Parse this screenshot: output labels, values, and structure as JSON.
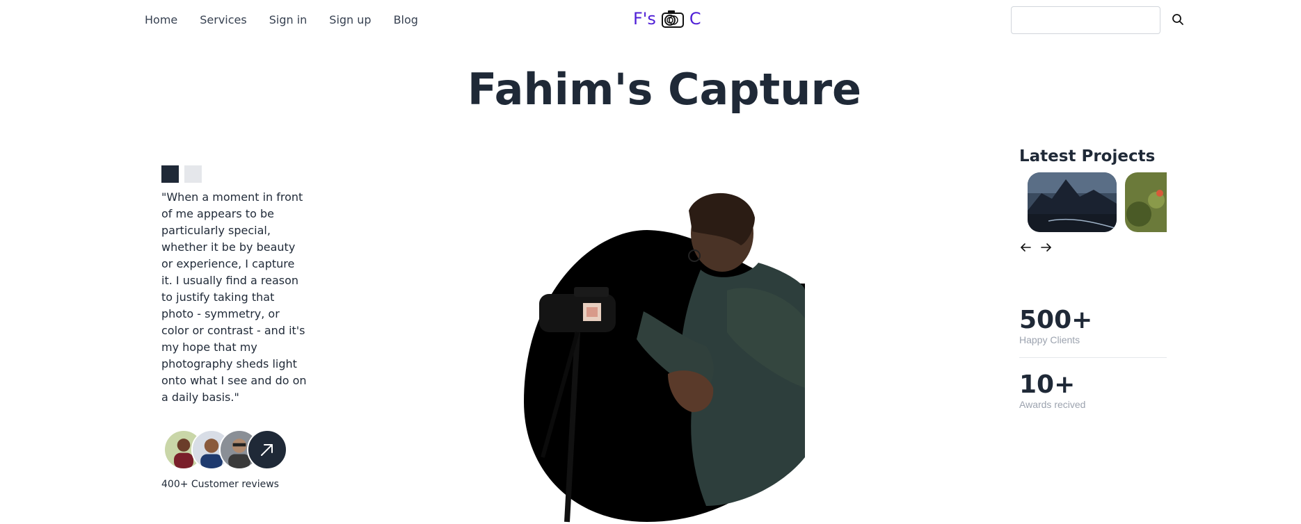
{
  "nav": {
    "links": [
      "Home",
      "Services",
      "Sign in",
      "Sign up",
      "Blog"
    ]
  },
  "logo": {
    "left": "F's",
    "right": "C"
  },
  "search": {
    "placeholder": ""
  },
  "hero": {
    "title": "Fahim's Capture"
  },
  "testimonial": {
    "quote": "\"When a moment in front of me appears to be particularly special, whether it be by beauty or experience, I capture it. I usually find a reason to justify taking that photo - symmetry, or color or contrast - and it's my hope that my photography sheds light onto what I see and do on a daily basis.\"",
    "reviews_label": "400+ Customer reviews"
  },
  "latest_projects": {
    "title": "Latest Projects"
  },
  "stats": [
    {
      "value": "500+",
      "label": "Happy Clients"
    },
    {
      "value": "10+",
      "label": "Awards recived"
    }
  ],
  "colors": {
    "accent": "#4f1fd6",
    "dark": "#1f2937",
    "muted": "#9ca3af"
  }
}
